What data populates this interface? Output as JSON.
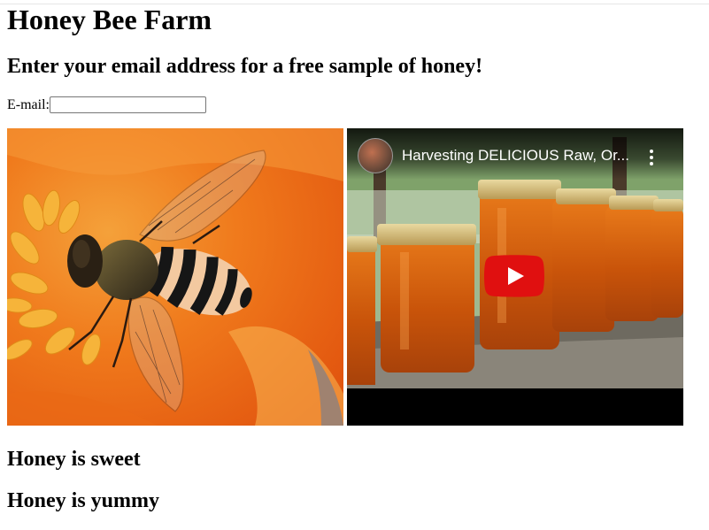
{
  "page": {
    "title": "Honey Bee Farm",
    "subtitle": "Enter your email address for a free sample of honey!"
  },
  "form": {
    "email_label": "E-mail:",
    "email_value": ""
  },
  "media": {
    "image_subject": "bee on orange flower",
    "video": {
      "title": "Harvesting DELICIOUS Raw, Or...",
      "icons": [
        "channel-avatar",
        "kebab-menu-icon",
        "youtube-play-icon"
      ],
      "play_color": "#ff0000"
    }
  },
  "captions": {
    "first": "Honey is sweet",
    "second": "Honey is yummy"
  }
}
